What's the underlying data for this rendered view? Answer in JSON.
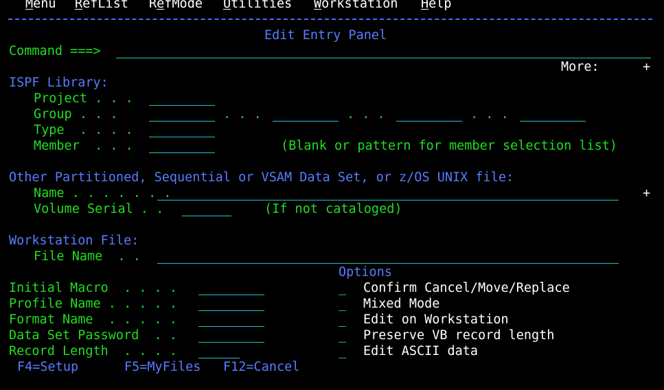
{
  "menu": [
    {
      "pre": "",
      "u": "M",
      "post": "enu"
    },
    {
      "pre": "",
      "u": "R",
      "post": "efList"
    },
    {
      "pre": "R",
      "u": "e",
      "post": "fMode"
    },
    {
      "pre": "",
      "u": "U",
      "post": "tilities"
    },
    {
      "pre": "",
      "u": "W",
      "post": "orkstation"
    },
    {
      "pre": "",
      "u": "H",
      "post": "elp"
    }
  ],
  "panel_title": "Edit Entry Panel",
  "command_label": "Command ===>",
  "more": {
    "label": "More:",
    "indicator": "+"
  },
  "ispf": {
    "heading": "ISPF Library:",
    "project_label": "Project . . .",
    "group_label": "Group . . .",
    "group_sep": ". . .",
    "type_label": "Type  . . . .",
    "member_label": "Member  . . .",
    "member_note": "(Blank or pattern for member selection list)"
  },
  "other": {
    "heading": "Other Partitioned, Sequential or VSAM Data Set, or z/OS UNIX file:",
    "name_label": "Name . . . . . . .",
    "name_plus": "+",
    "volume_label": "Volume Serial . .",
    "volume_note": "(If not cataloged)"
  },
  "workstation": {
    "heading": "Workstation File:",
    "file_label": "File Name  . ."
  },
  "options": {
    "heading": "Options",
    "items": [
      "Confirm Cancel/Move/Replace",
      "Mixed Mode",
      "Edit on Workstation",
      "Preserve VB record length",
      "Edit ASCII data"
    ],
    "checkbox_glyph": "_"
  },
  "fields": {
    "initial_macro": "Initial Macro  . . . .",
    "profile_name": "Profile Name . . . . .",
    "format_name": "Format Name  . . . . .",
    "data_set_password": "Data Set Password  . .",
    "record_length": "Record Length  . . . ."
  },
  "pf_keys": [
    "F4=Setup",
    "F5=MyFiles",
    "F12=Cancel"
  ]
}
